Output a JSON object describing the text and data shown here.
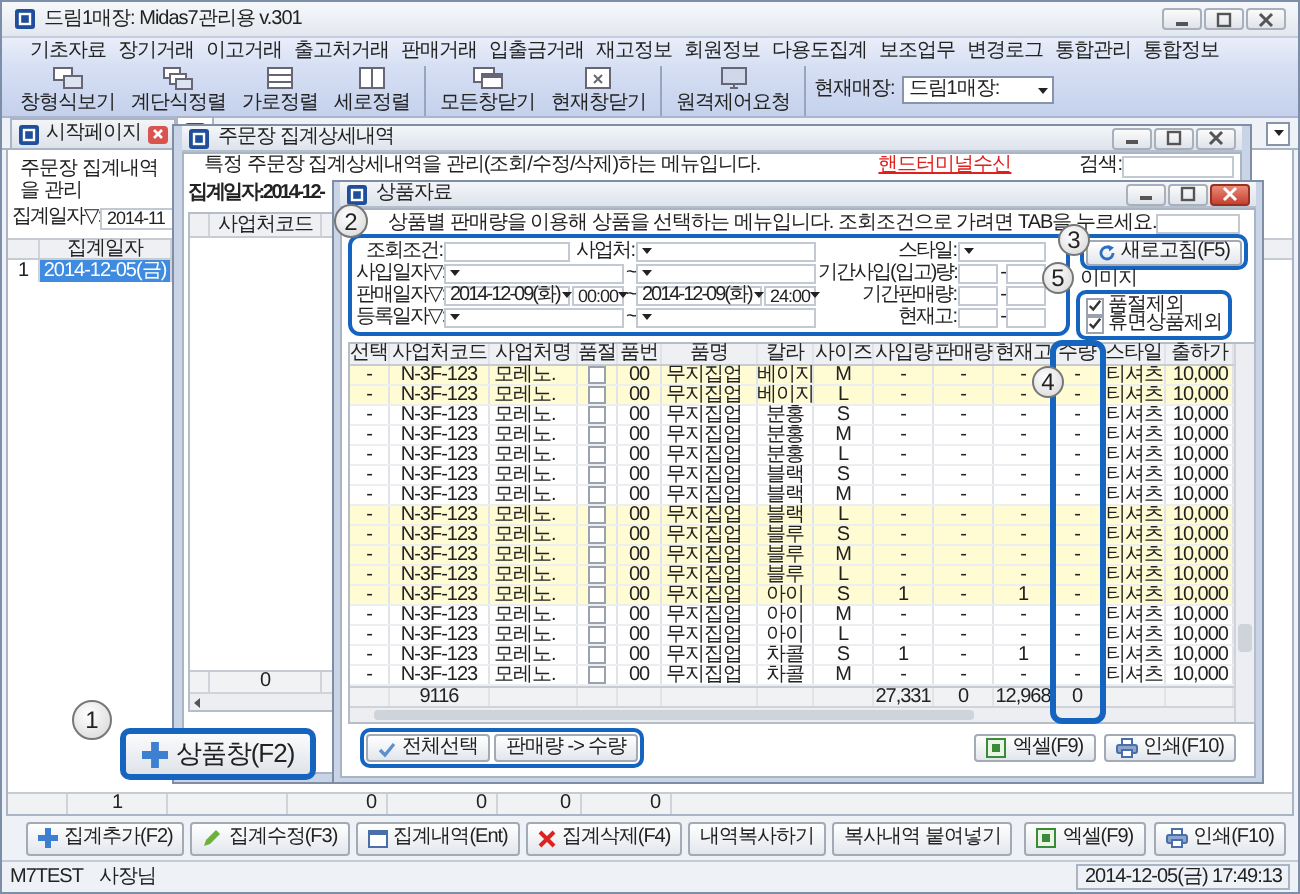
{
  "window": {
    "title": "드림1매장: Midas7관리용 v.301"
  },
  "menu": [
    "기초자료",
    "장기거래",
    "이고거래",
    "출고처거래",
    "판매거래",
    "입출금거래",
    "재고정보",
    "회원정보",
    "다용도집계",
    "보조업무",
    "변경로그",
    "통합관리",
    "통합정보"
  ],
  "toolbar": {
    "groups": [
      [
        {
          "label": "창형식보기",
          "kind": "cascade"
        },
        {
          "label": "계단식정렬",
          "kind": "stairs"
        },
        {
          "label": "가로정렬",
          "kind": "horizontal"
        },
        {
          "label": "세로정렬",
          "kind": "vertical"
        }
      ],
      [
        {
          "label": "모든창닫기",
          "kind": "close_all"
        },
        {
          "label": "현재창닫기",
          "kind": "close_current"
        }
      ],
      [
        {
          "label": "원격제어요청",
          "kind": "remote"
        }
      ]
    ],
    "store_label": "현재매장:",
    "store_value": "드림1매장:"
  },
  "tabs": [
    {
      "label": "시작페이지",
      "selected": false
    },
    {
      "selected": true
    }
  ],
  "order_summary": {
    "description": "주문장 집계내역을 관리",
    "date_label": "집계일자▽:",
    "date_value": "2014-11",
    "columns": [
      "집계일자"
    ],
    "rows": [
      {
        "no": "1",
        "date": "2014-12-05(금)",
        "selected": true
      }
    ],
    "footer": [
      "1",
      "0",
      "0",
      "0",
      "0"
    ],
    "buttons": [
      {
        "label": "집계추가(F2)",
        "kind": "add"
      },
      {
        "label": "집계수정(F3)",
        "kind": "edit"
      },
      {
        "label": "집계내역(Ent)",
        "kind": "detail"
      },
      {
        "label": "집계삭제(F4)",
        "kind": "delete"
      },
      {
        "label": "내역복사하기",
        "kind": "plain"
      },
      {
        "label": "복사내역 붙여넣기",
        "kind": "plain"
      }
    ],
    "export_buttons": [
      {
        "label": "엑셀(F9)",
        "kind": "excel"
      },
      {
        "label": "인쇄(F10)",
        "kind": "print"
      }
    ]
  },
  "status_bar": {
    "user": "M7TEST",
    "role": "사장님",
    "datetime": "2014-12-05(금) 17:49:13"
  },
  "detail_window": {
    "title": "주문장 집계상세내역",
    "description": "특정 주문장 집계상세내역을 관리(조회/수정/삭제)하는 메뉴입니다.",
    "link": "핸드터미널수신",
    "search_label": "검색:",
    "date_heading": "집계일자:2014-12-",
    "columns": [
      "사업처코드"
    ],
    "footer": [
      "0"
    ]
  },
  "product_window": {
    "title": "상품자료",
    "description": "상품별 판매량을 이용해 상품을 선택하는 메뉴입니다. 조회조건으로 가려면 TAB을 누르세요.",
    "filters": {
      "query": {
        "label": "조회조건:"
      },
      "vendor": {
        "label": "사업처:"
      },
      "style": {
        "label": "스타일:"
      },
      "purchase_date": {
        "label": "사입일자▽:",
        "separator": "~"
      },
      "purchase_amount": {
        "label": "기간사입(입고)량:",
        "separator": "-"
      },
      "sale_date": {
        "label": "판매일자▽:",
        "from": "2014-12-09(화)",
        "from_time": "00:00",
        "separator": "~",
        "to": "2014-12-09(화)",
        "to_time": "24:00"
      },
      "sale_amount": {
        "label": "기간판매량:",
        "separator": "-"
      },
      "register_date": {
        "label": "등록일자▽:",
        "separator": "~"
      },
      "stock": {
        "label": "현재고:",
        "separator": "-"
      }
    },
    "image_label": "이미지",
    "refresh_button": "새로고침(F5)",
    "exclusions": [
      {
        "label": "품절제외",
        "checked": true
      },
      {
        "label": "휴면상품제외",
        "checked": true
      }
    ],
    "columns": [
      {
        "label": "선택",
        "kind": "text"
      },
      {
        "label": "사업처코드",
        "kind": "text"
      },
      {
        "label": "사업처명",
        "kind": "text"
      },
      {
        "label": "품절",
        "kind": "check"
      },
      {
        "label": "품번",
        "kind": "text"
      },
      {
        "label": "품명",
        "kind": "text"
      },
      {
        "label": "칼라",
        "kind": "text"
      },
      {
        "label": "사이즈",
        "kind": "text"
      },
      {
        "label": "사입량",
        "kind": "text"
      },
      {
        "label": "판매량",
        "kind": "text"
      },
      {
        "label": "현재고",
        "kind": "text"
      },
      {
        "label": "수량",
        "kind": "text"
      },
      {
        "label": "스타일",
        "kind": "text"
      },
      {
        "label": "출하가",
        "kind": "text"
      }
    ],
    "rows": [
      {
        "cells": [
          "-",
          "N-3F-123",
          "모레노.",
          "",
          "00",
          "무지집업",
          "베이지",
          "M",
          "-",
          "-",
          "-",
          "-",
          "티셔츠",
          "10,000"
        ],
        "soldout": false,
        "highlighted": true
      },
      {
        "cells": [
          "-",
          "N-3F-123",
          "모레노.",
          "",
          "00",
          "무지집업",
          "베이지",
          "L",
          "-",
          "-",
          "-",
          "-",
          "티셔츠",
          "10,000"
        ],
        "soldout": false,
        "highlighted": true
      },
      {
        "cells": [
          "-",
          "N-3F-123",
          "모레노.",
          "",
          "00",
          "무지집업",
          "분홍",
          "S",
          "-",
          "-",
          "-",
          "-",
          "티셔츠",
          "10,000"
        ],
        "soldout": false,
        "highlighted": false
      },
      {
        "cells": [
          "-",
          "N-3F-123",
          "모레노.",
          "",
          "00",
          "무지집업",
          "분홍",
          "M",
          "-",
          "-",
          "-",
          "-",
          "티셔츠",
          "10,000"
        ],
        "soldout": false,
        "highlighted": false
      },
      {
        "cells": [
          "-",
          "N-3F-123",
          "모레노.",
          "",
          "00",
          "무지집업",
          "분홍",
          "L",
          "-",
          "-",
          "-",
          "-",
          "티셔츠",
          "10,000"
        ],
        "soldout": false,
        "highlighted": false
      },
      {
        "cells": [
          "-",
          "N-3F-123",
          "모레노.",
          "",
          "00",
          "무지집업",
          "블랙",
          "S",
          "-",
          "-",
          "-",
          "-",
          "티셔츠",
          "10,000"
        ],
        "soldout": false,
        "highlighted": false
      },
      {
        "cells": [
          "-",
          "N-3F-123",
          "모레노.",
          "",
          "00",
          "무지집업",
          "블랙",
          "M",
          "-",
          "-",
          "-",
          "-",
          "티셔츠",
          "10,000"
        ],
        "soldout": false,
        "highlighted": false
      },
      {
        "cells": [
          "-",
          "N-3F-123",
          "모레노.",
          "",
          "00",
          "무지집업",
          "블랙",
          "L",
          "-",
          "-",
          "-",
          "-",
          "티셔츠",
          "10,000"
        ],
        "soldout": false,
        "highlighted": true
      },
      {
        "cells": [
          "-",
          "N-3F-123",
          "모레노.",
          "",
          "00",
          "무지집업",
          "블루",
          "S",
          "-",
          "-",
          "-",
          "-",
          "티셔츠",
          "10,000"
        ],
        "soldout": false,
        "highlighted": true
      },
      {
        "cells": [
          "-",
          "N-3F-123",
          "모레노.",
          "",
          "00",
          "무지집업",
          "블루",
          "M",
          "-",
          "-",
          "-",
          "-",
          "티셔츠",
          "10,000"
        ],
        "soldout": false,
        "highlighted": true
      },
      {
        "cells": [
          "-",
          "N-3F-123",
          "모레노.",
          "",
          "00",
          "무지집업",
          "블루",
          "L",
          "-",
          "-",
          "-",
          "-",
          "티셔츠",
          "10,000"
        ],
        "soldout": false,
        "highlighted": true
      },
      {
        "cells": [
          "-",
          "N-3F-123",
          "모레노.",
          "",
          "00",
          "무지집업",
          "아이",
          "S",
          "1",
          "-",
          "1",
          "-",
          "티셔츠",
          "10,000"
        ],
        "soldout": false,
        "highlighted": true
      },
      {
        "cells": [
          "-",
          "N-3F-123",
          "모레노.",
          "",
          "00",
          "무지집업",
          "아이",
          "M",
          "-",
          "-",
          "-",
          "-",
          "티셔츠",
          "10,000"
        ],
        "soldout": false,
        "highlighted": false
      },
      {
        "cells": [
          "-",
          "N-3F-123",
          "모레노.",
          "",
          "00",
          "무지집업",
          "아이",
          "L",
          "-",
          "-",
          "-",
          "-",
          "티셔츠",
          "10,000"
        ],
        "soldout": false,
        "highlighted": false
      },
      {
        "cells": [
          "-",
          "N-3F-123",
          "모레노.",
          "",
          "00",
          "무지집업",
          "차콜",
          "S",
          "1",
          "-",
          "1",
          "-",
          "티셔츠",
          "10,000"
        ],
        "soldout": false,
        "highlighted": false
      },
      {
        "cells": [
          "-",
          "N-3F-123",
          "모레노.",
          "",
          "00",
          "무지집업",
          "차콜",
          "M",
          "-",
          "-",
          "-",
          "-",
          "티셔츠",
          "10,000"
        ],
        "soldout": false,
        "highlighted": false
      }
    ],
    "totals": {
      "business_code": "9116",
      "purchase_qty": "27,331",
      "sales_qty": "0",
      "stock": "12,968",
      "quantity": "0"
    },
    "bottom_buttons": [
      {
        "label": "전체선택",
        "kind": "check"
      },
      {
        "label": "판매량 -> 수량",
        "kind": "plain"
      }
    ],
    "export_buttons": [
      {
        "label": "엑셀(F9)",
        "kind": "excel"
      },
      {
        "label": "인쇄(F10)",
        "kind": "print"
      }
    ]
  },
  "product_button": {
    "label": "상품창(F2)"
  },
  "annotations": [
    "1",
    "2",
    "3",
    "4",
    "5"
  ]
}
